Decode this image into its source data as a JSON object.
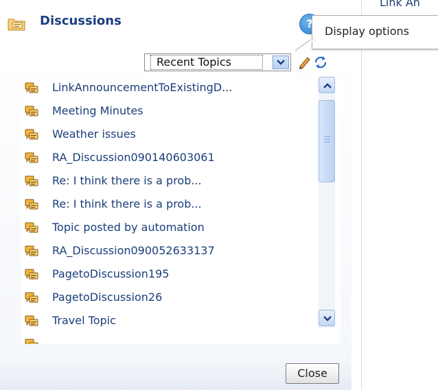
{
  "panel": {
    "title": "Discussions",
    "right_partial_text": "Link An",
    "help_icon": "help-icon",
    "help_glyph": "?",
    "tooltip": "Display options"
  },
  "filter": {
    "selected": "Recent Topics",
    "edit_icon": "pencil-icon",
    "refresh_icon": "refresh-icon"
  },
  "topics": [
    "LinkAnnouncementToExistingD...",
    "Meeting Minutes",
    "Weather issues",
    "RA_Discussion090140603061",
    "Re: I think there is a prob...",
    "Re: I think there is a prob...",
    "Topic posted by automation",
    "RA_Discussion090052633137",
    "PagetoDiscussion195",
    "PagetoDiscussion26",
    "Travel Topic"
  ],
  "buttons": {
    "close": "Close"
  },
  "colors": {
    "title": "#1b3e7e",
    "link": "#1a3e7a",
    "scroll": "#c3d7f4"
  }
}
